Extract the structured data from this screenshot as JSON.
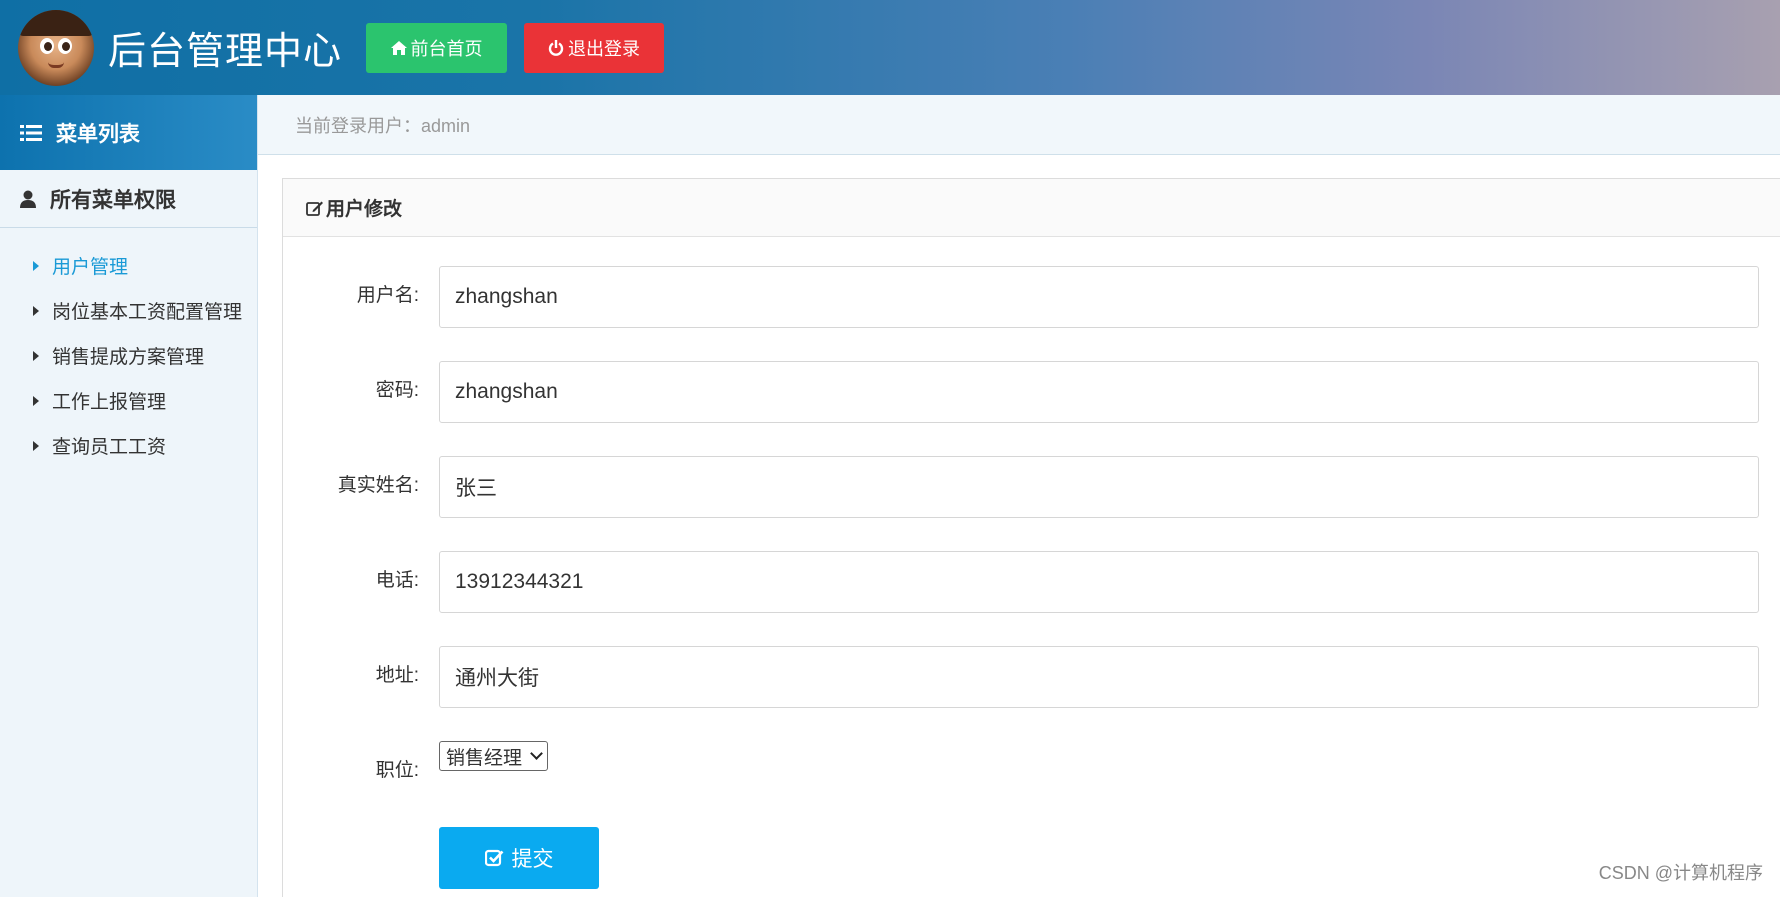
{
  "header": {
    "site_title": "后台管理中心",
    "home_label": "前台首页",
    "logout_label": "退出登录"
  },
  "sidebar": {
    "menu_title": "菜单列表",
    "group_title": "所有菜单权限",
    "items": [
      {
        "label": "用户管理",
        "active": true
      },
      {
        "label": "岗位基本工资配置管理",
        "active": false
      },
      {
        "label": "销售提成方案管理",
        "active": false
      },
      {
        "label": "工作上报管理",
        "active": false
      },
      {
        "label": "查询员工工资",
        "active": false
      }
    ]
  },
  "breadcrumb": {
    "text": "当前登录用户：admin"
  },
  "form": {
    "title": "用户修改",
    "fields": {
      "username": {
        "label": "用户名:",
        "value": "zhangshan"
      },
      "password": {
        "label": "密码:",
        "value": "zhangshan"
      },
      "realname": {
        "label": "真实姓名:",
        "value": "张三"
      },
      "phone": {
        "label": "电话:",
        "value": "13912344321"
      },
      "address": {
        "label": "地址:",
        "value": "通州大街"
      },
      "position": {
        "label": "职位:",
        "selected": "销售经理"
      }
    },
    "submit_label": "提交"
  },
  "watermark": "CSDN @计算机程序",
  "colors": {
    "home_button": "#2bc46e",
    "logout_button": "#ea3337",
    "submit_button": "#0aaaf0",
    "active_menu": "#1a9ad6"
  }
}
